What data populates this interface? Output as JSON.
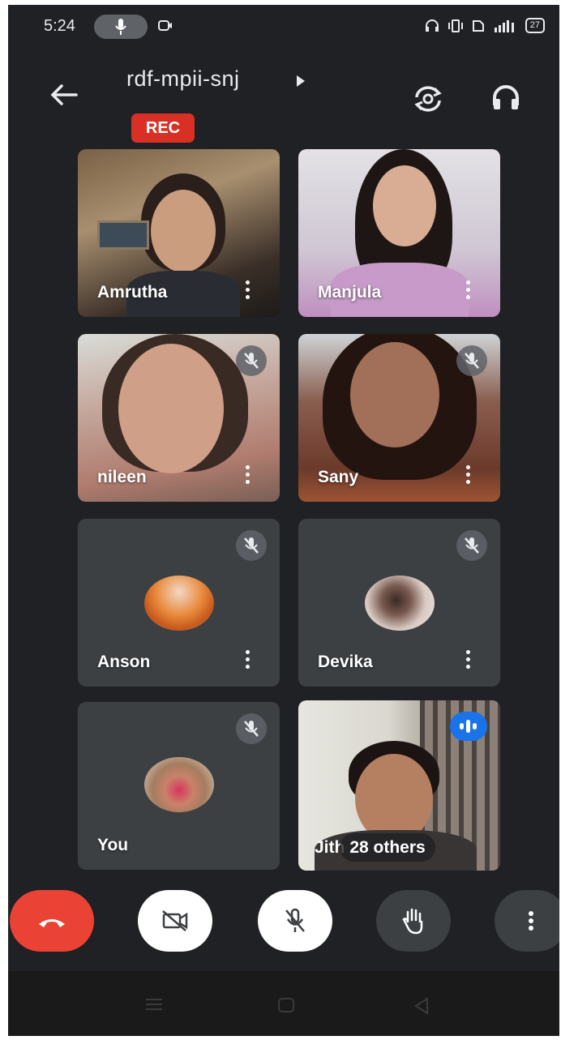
{
  "status_bar": {
    "time": "5:24",
    "battery": "27"
  },
  "header": {
    "meeting_code": "rdf-mpii-snj",
    "recording_badge": "REC"
  },
  "participants": [
    {
      "name": "Amrutha",
      "muted": false,
      "video": true
    },
    {
      "name": "Manjula",
      "muted": false,
      "video": true
    },
    {
      "name": "nileen",
      "muted": true,
      "video": true
    },
    {
      "name": "Sany",
      "muted": true,
      "video": true
    },
    {
      "name": "Anson",
      "muted": true,
      "video": false
    },
    {
      "name": "Devika",
      "muted": true,
      "video": false
    },
    {
      "name": "You",
      "muted": true,
      "video": false
    },
    {
      "name": "Jith",
      "muted": false,
      "video": true,
      "speaking": true
    }
  ],
  "others": {
    "label": "28 others"
  },
  "controls": {
    "end_call_icon": "phone-hangup-icon",
    "camera_icon": "video-off-icon",
    "mic_icon": "mic-off-icon",
    "hand_icon": "raise-hand-icon",
    "more_icon": "more-vert-icon"
  },
  "colors": {
    "background": "#202124",
    "tile": "#3c4043",
    "end_call": "#ea4335",
    "rec": "#d93025",
    "speaking": "#1a73e8"
  }
}
